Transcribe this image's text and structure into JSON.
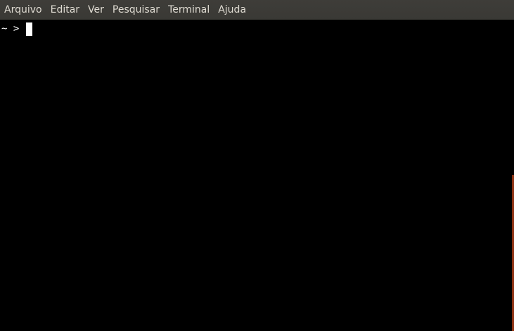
{
  "menubar": {
    "items": [
      {
        "label": "Arquivo"
      },
      {
        "label": "Editar"
      },
      {
        "label": "Ver"
      },
      {
        "label": "Pesquisar"
      },
      {
        "label": "Terminal"
      },
      {
        "label": "Ajuda"
      }
    ]
  },
  "terminal": {
    "prompt": "~ > ",
    "input": ""
  },
  "colors": {
    "background": "#000000",
    "menubar": "#3c3b37",
    "menu_text": "#dfdbd2",
    "scrollbar": "#e95420"
  }
}
